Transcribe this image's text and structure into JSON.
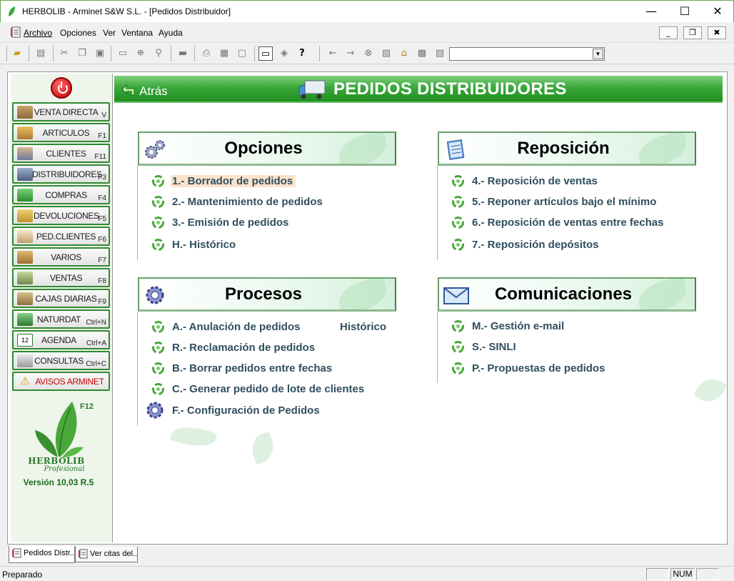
{
  "window": {
    "title": "HERBOLIB - Arminet S&W S.L. - [Pedidos Distribuidor]",
    "minimize_glyph": "—",
    "maximize_glyph": "☐",
    "close_glyph": "✕"
  },
  "menubar": {
    "items": [
      "Archivo",
      "Opciones",
      "Ver",
      "Ventana",
      "Ayuda"
    ],
    "mdi_minimize": "_",
    "mdi_restore": "❐",
    "mdi_close": "✖"
  },
  "toolbar": {
    "icons": [
      "open-folder-icon",
      "properties-icon",
      "cut-icon",
      "copy-icon",
      "paste-icon",
      "window-icon",
      "binoculars-icon",
      "zoom-icon",
      "ruler-icon",
      "print-icon",
      "print-preview-icon",
      "page-setup-icon",
      "screen-icon",
      "eraser-icon",
      "help-icon",
      "back-arrow-icon",
      "forward-arrow-icon",
      "stop-icon",
      "refresh-icon",
      "home-icon",
      "search-web-icon",
      "go-icon"
    ],
    "address_value": ""
  },
  "sidebar": {
    "items": [
      {
        "label": "VENTA DIRECTA",
        "key": "V",
        "icon": "cash-register-icon"
      },
      {
        "label": "ARTICULOS",
        "key": "F1",
        "icon": "articles-icon"
      },
      {
        "label": "CLIENTES",
        "key": "F11",
        "icon": "clients-icon"
      },
      {
        "label": "DISTRIBUIDORES",
        "key": "F3",
        "icon": "truck-icon"
      },
      {
        "label": "COMPRAS",
        "key": "F4",
        "icon": "basket-icon"
      },
      {
        "label": "DEVOLUCIONES",
        "key": "F5",
        "icon": "returns-icon"
      },
      {
        "label": "PED.CLIENTES",
        "key": "F6",
        "icon": "client-orders-icon"
      },
      {
        "label": "VARIOS",
        "key": "F7",
        "icon": "box-icon"
      },
      {
        "label": "VENTAS",
        "key": "F8",
        "icon": "sales-icon"
      },
      {
        "label": "CAJAS DIARIAS",
        "key": "F9",
        "icon": "cash-box-icon"
      },
      {
        "label": "NATURDAT",
        "key": "Ctrl+N",
        "icon": "plant-icon"
      },
      {
        "label": "AGENDA",
        "key": "Ctrl+A",
        "icon": "calendar-icon"
      },
      {
        "label": "CONSULTAS",
        "key": "Ctrl+C",
        "icon": "queries-icon"
      },
      {
        "label": "AVISOS ARMINET",
        "key": "",
        "icon": "warning-icon"
      }
    ],
    "logo_key": "F12",
    "brand": "HERBOLIB",
    "brand_sub": "Profesional",
    "version": "Versión 10,03 R.5"
  },
  "header": {
    "back_label": "Atrás",
    "title": "PEDIDOS DISTRIBUIDORES"
  },
  "sections": {
    "opciones": {
      "title": "Opciones",
      "items": [
        "1.- Borrador de pedidos",
        "2.- Mantenimiento de pedidos",
        "3.- Emisión de pedidos",
        "H.- Histórico"
      ]
    },
    "reposicion": {
      "title": "Reposición",
      "items": [
        "4.- Reposición de ventas",
        "5.- Reponer artículos bajo el mínimo",
        "6.- Reposición de ventas entre fechas",
        "7.- Reposición depósitos"
      ]
    },
    "procesos": {
      "title": "Procesos",
      "items": [
        "A.- Anulación de pedidos",
        "R.- Reclamación de pedidos",
        "B.- Borrar pedidos entre fechas",
        "C.- Generar pedido de lote de clientes",
        "F.- Configuración de Pedidos"
      ],
      "extra_label": "Histórico"
    },
    "comunicaciones": {
      "title": "Comunicaciones",
      "items": [
        "M.- Gestión e-mail",
        "S.- SINLI",
        "P.- Propuestas de pedidos"
      ]
    }
  },
  "tabs": [
    "Pedidos Distr...",
    "Ver citas del..."
  ],
  "statusbar": {
    "text": "Preparado",
    "num": "NUM"
  },
  "colors": {
    "accent_green": "#2f8a2f",
    "header_green": "#3aa83a",
    "option_text": "#2f4f5f",
    "highlight": "#fbe3cb",
    "alert_red": "#c00000"
  }
}
